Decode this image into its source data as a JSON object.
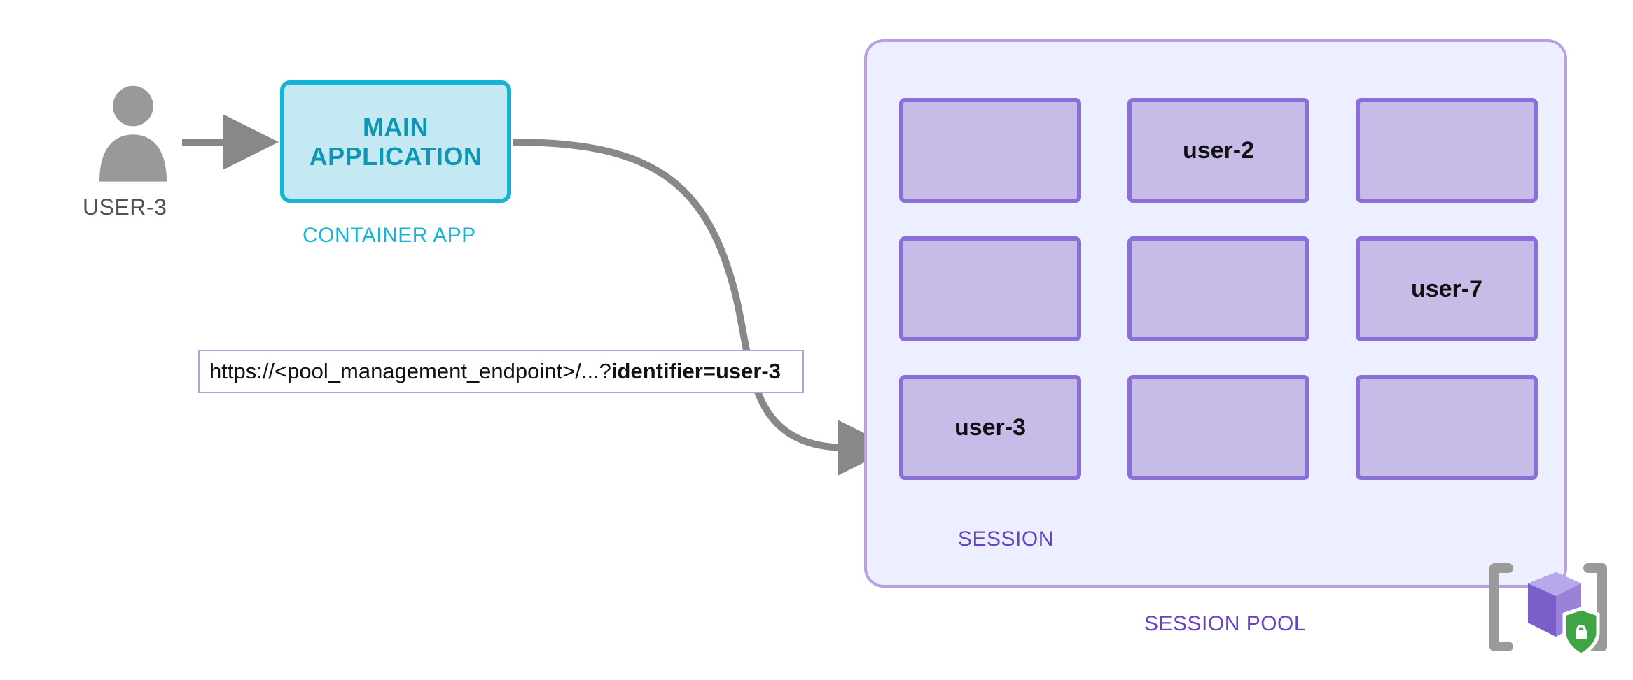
{
  "user": {
    "label": "USER-3"
  },
  "mainApp": {
    "line1": "MAIN",
    "line2": "APPLICATION",
    "caption": "CONTAINER APP"
  },
  "url": {
    "prefix": "https://<pool_management_endpoint>/...?",
    "suffix": "identifier=user-3"
  },
  "sessionPool": {
    "caption": "SESSION POOL",
    "sessionCaption": "SESSION",
    "cells": [
      "",
      "user-2",
      "",
      "",
      "",
      "user-7",
      "user-3",
      "",
      ""
    ]
  },
  "colors": {
    "userGray": "#999999",
    "appBorder": "#14b4d6",
    "appFill": "#c4e9f2",
    "poolBorder": "#b79fe0",
    "poolFill": "#ecefff",
    "sessionBorder": "#8b6ed6",
    "sessionFill": "#c7bbe8",
    "purpleText": "#6842c2",
    "arrowGray": "#888888"
  }
}
